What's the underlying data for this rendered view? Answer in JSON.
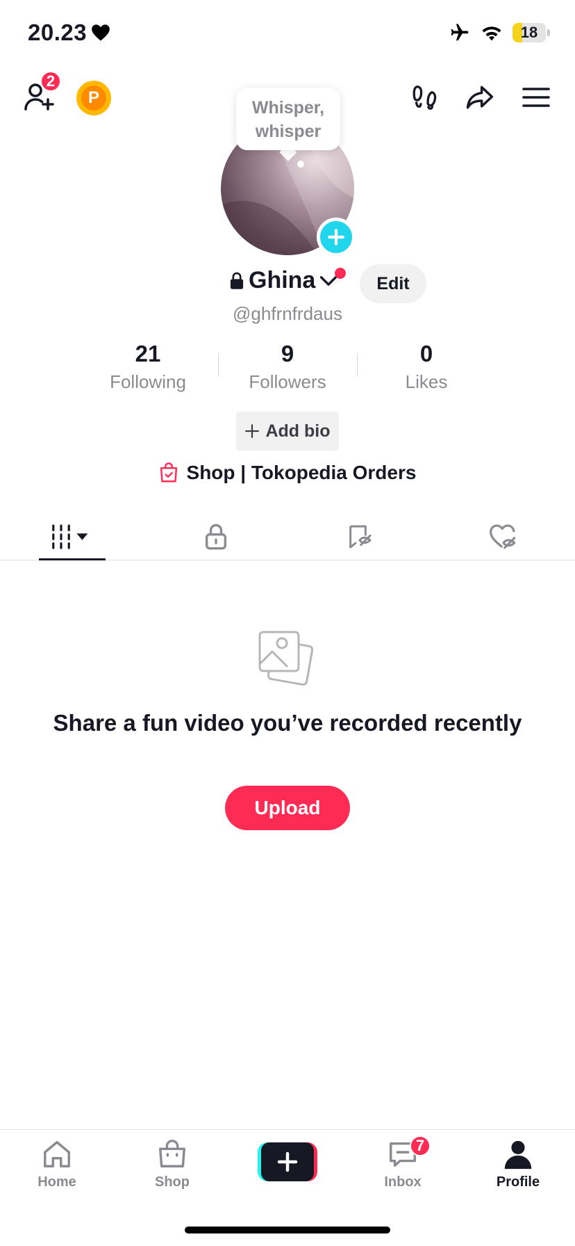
{
  "status_bar": {
    "time": "20.23",
    "battery": "18"
  },
  "header": {
    "friends_badge": "2",
    "points_label": "P"
  },
  "avatar": {
    "bubble_text": "Whisper, whisper"
  },
  "profile": {
    "name": "Ghina",
    "handle": "@ghfrnfrdaus",
    "edit_label": "Edit"
  },
  "stats": [
    {
      "value": "21",
      "label": "Following"
    },
    {
      "value": "9",
      "label": "Followers"
    },
    {
      "value": "0",
      "label": "Likes"
    }
  ],
  "bio": {
    "add_label": "Add bio"
  },
  "shop": {
    "label": "Shop | Tokopedia Orders"
  },
  "empty_state": {
    "title": "Share a fun video you’ve recorded recently",
    "button": "Upload"
  },
  "nav": {
    "items": [
      {
        "label": "Home"
      },
      {
        "label": "Shop"
      },
      {
        "label": "Inbox",
        "badge": "7"
      },
      {
        "label": "Profile"
      }
    ]
  },
  "colors": {
    "accent": "#fe2c55",
    "cyan": "#20d5ec",
    "text": "#161823",
    "muted": "#8a8b91"
  }
}
